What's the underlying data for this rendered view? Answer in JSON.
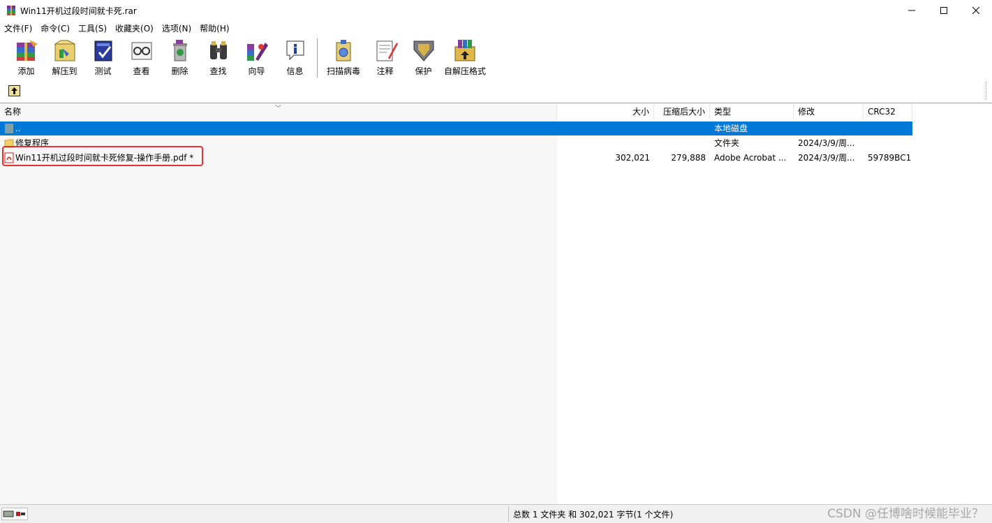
{
  "window": {
    "title": "Win11开机过段时间就卡死.rar",
    "icon": "winrar-icon"
  },
  "menu": [
    "文件(F)",
    "命令(C)",
    "工具(S)",
    "收藏夹(O)",
    "选项(N)",
    "帮助(H)"
  ],
  "toolbar": {
    "buttons": [
      {
        "label": "添加",
        "icon": "add-archive-icon"
      },
      {
        "label": "解压到",
        "icon": "extract-to-icon"
      },
      {
        "label": "测试",
        "icon": "test-icon"
      },
      {
        "label": "查看",
        "icon": "view-icon"
      },
      {
        "label": "删除",
        "icon": "delete-icon"
      },
      {
        "label": "查找",
        "icon": "find-icon"
      },
      {
        "label": "向导",
        "icon": "wizard-icon"
      },
      {
        "label": "信息",
        "icon": "info-icon"
      },
      {
        "label": "扫描病毒",
        "icon": "virus-scan-icon"
      },
      {
        "label": "注释",
        "icon": "comment-icon"
      },
      {
        "label": "保护",
        "icon": "protect-icon"
      },
      {
        "label": "自解压格式",
        "icon": "sfx-icon"
      }
    ]
  },
  "columns": {
    "name": "名称",
    "size": "大小",
    "packed": "压缩后大小",
    "type": "类型",
    "modified": "修改",
    "crc": "CRC32"
  },
  "rows": [
    {
      "name": "..",
      "size": "",
      "packed": "",
      "type": "本地磁盘",
      "modified": "",
      "crc": "",
      "selected": true
    },
    {
      "name": "修复程序",
      "size": "",
      "packed": "",
      "type": "文件夹",
      "modified": "2024/3/9/周...",
      "crc": ""
    },
    {
      "name": "Win11开机过段时间就卡死修复-操作手册.pdf *",
      "size": "302,021",
      "packed": "279,888",
      "type": "Adobe Acrobat ...",
      "modified": "2024/3/9/周...",
      "crc": "59789BC1"
    }
  ],
  "status": {
    "summary": "总数 1 文件夹 和 302,021 字节(1 个文件)",
    "watermark": "CSDN @任博啥时候能毕业？"
  },
  "colors": {
    "selection": "#0078d7",
    "highlight_border": "#e53030"
  }
}
